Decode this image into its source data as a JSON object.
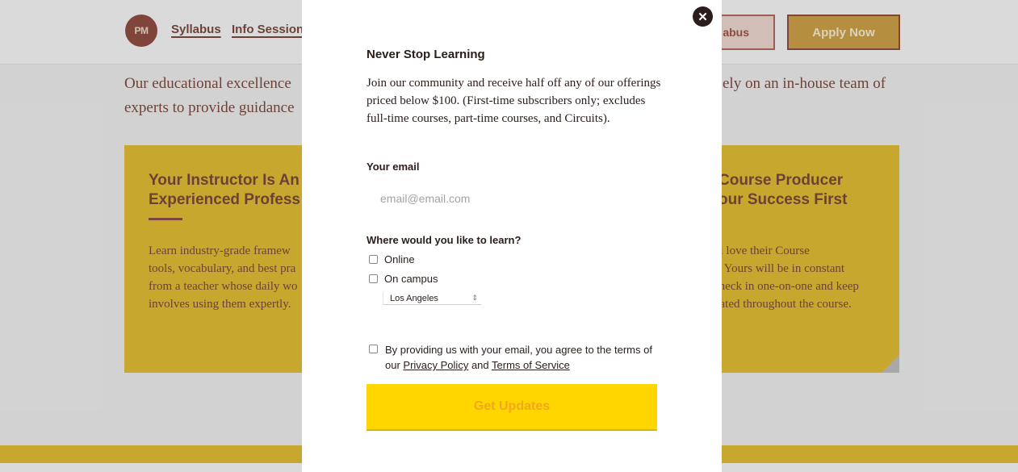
{
  "background": {
    "logo_text": "PM",
    "nav": {
      "syllabus": "Syllabus",
      "info_session": "Info Session"
    },
    "buttons": {
      "syllabus_partial": "abus",
      "apply": "Apply Now"
    },
    "intro_left": [
      "Our educational excellence",
      "experts to provide guidance"
    ],
    "intro_right": "ely on an in-house team of",
    "card_left": {
      "title": [
        "Your Instructor Is An",
        "Experienced Profess"
      ],
      "body": [
        "Learn industry-grade framew",
        "tools, vocabulary, and best pra",
        "from a teacher whose daily wo",
        "involves using them expertly. "
      ]
    },
    "card_right": {
      "title": [
        "Course Producer",
        "our Success First"
      ],
      "body": [
        "ni love their Course",
        "s. Yours will be in constant",
        "check in one-on-one and keep",
        "vated throughout the course."
      ]
    }
  },
  "modal": {
    "title": "Never Stop Learning",
    "description": "Join our community and receive half off any of our offerings priced below $100. (First-time subscribers only; excludes full-time courses, part-time courses, and Circuits).",
    "email_label": "Your email",
    "email_placeholder": "email@email.com",
    "email_value": "",
    "location_label": "Where would you like to learn?",
    "options": {
      "online": "Online",
      "campus": "On campus"
    },
    "campus_city": "Los Angeles",
    "terms_prefix": "By providing us with your email, you agree to the terms of our ",
    "privacy_link": "Privacy Policy",
    "terms_and": " and ",
    "tos_link": "Terms of Service",
    "submit_label": "Get Updates"
  }
}
